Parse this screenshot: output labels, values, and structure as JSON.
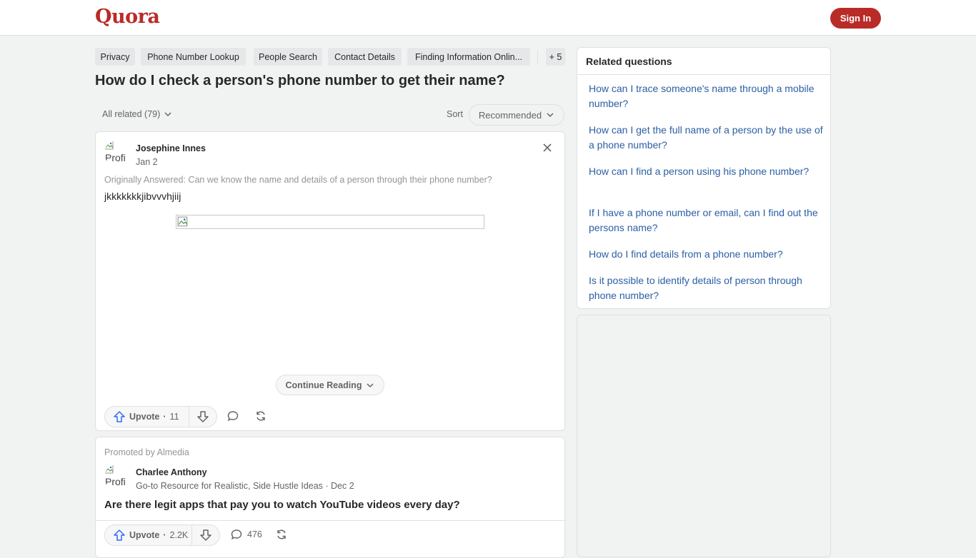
{
  "header": {
    "logo": "Quora",
    "signin_label": "Sign In"
  },
  "topics": [
    "Privacy",
    "Phone Number Lookup",
    "People Search",
    "Contact Details",
    "Finding Information Onlin...",
    "+ 5"
  ],
  "question": {
    "title": "How do I check a person's phone number to get their name?"
  },
  "filters": {
    "all_related": "All related (79)",
    "sort_label": "Sort",
    "sort_value": "Recommended"
  },
  "answer": {
    "avatar_alt": "Profi",
    "author": "Josephine Innes",
    "date": "Jan 2",
    "originally_answered": "Originally Answered: Can we know the name and details of a person through their phone number?",
    "text": "jkkkkkkkjibvvvhjiij",
    "continue_label": "Continue Reading",
    "upvote_label": "Upvote",
    "upvote_count": "11"
  },
  "promoted": {
    "promo_label": "Promoted by Almedia",
    "avatar_alt": "Profi",
    "author": "Charlee Anthony",
    "meta": "Go-to Resource for Realistic, Side Hustle Ideas · Dec 2",
    "title": "Are there legit apps that pay you to watch YouTube videos every day?",
    "upvote_label": "Upvote",
    "upvote_count": "2.2K",
    "comment_count": "476"
  },
  "related": {
    "heading": "Related questions",
    "items": [
      "How can I trace someone's name through a mobile number?",
      "How can I get the full name of a person by the use of a phone number?",
      "How can I find a person using his phone number?",
      "If I have a phone number or email, can I find out the persons name?",
      "How do I find details from a phone number?",
      "Is it possible to identify details of person through phone number?"
    ]
  },
  "colors": {
    "brand": "#b92b27",
    "link": "#2b5fa3",
    "background": "#f1f2f2"
  }
}
